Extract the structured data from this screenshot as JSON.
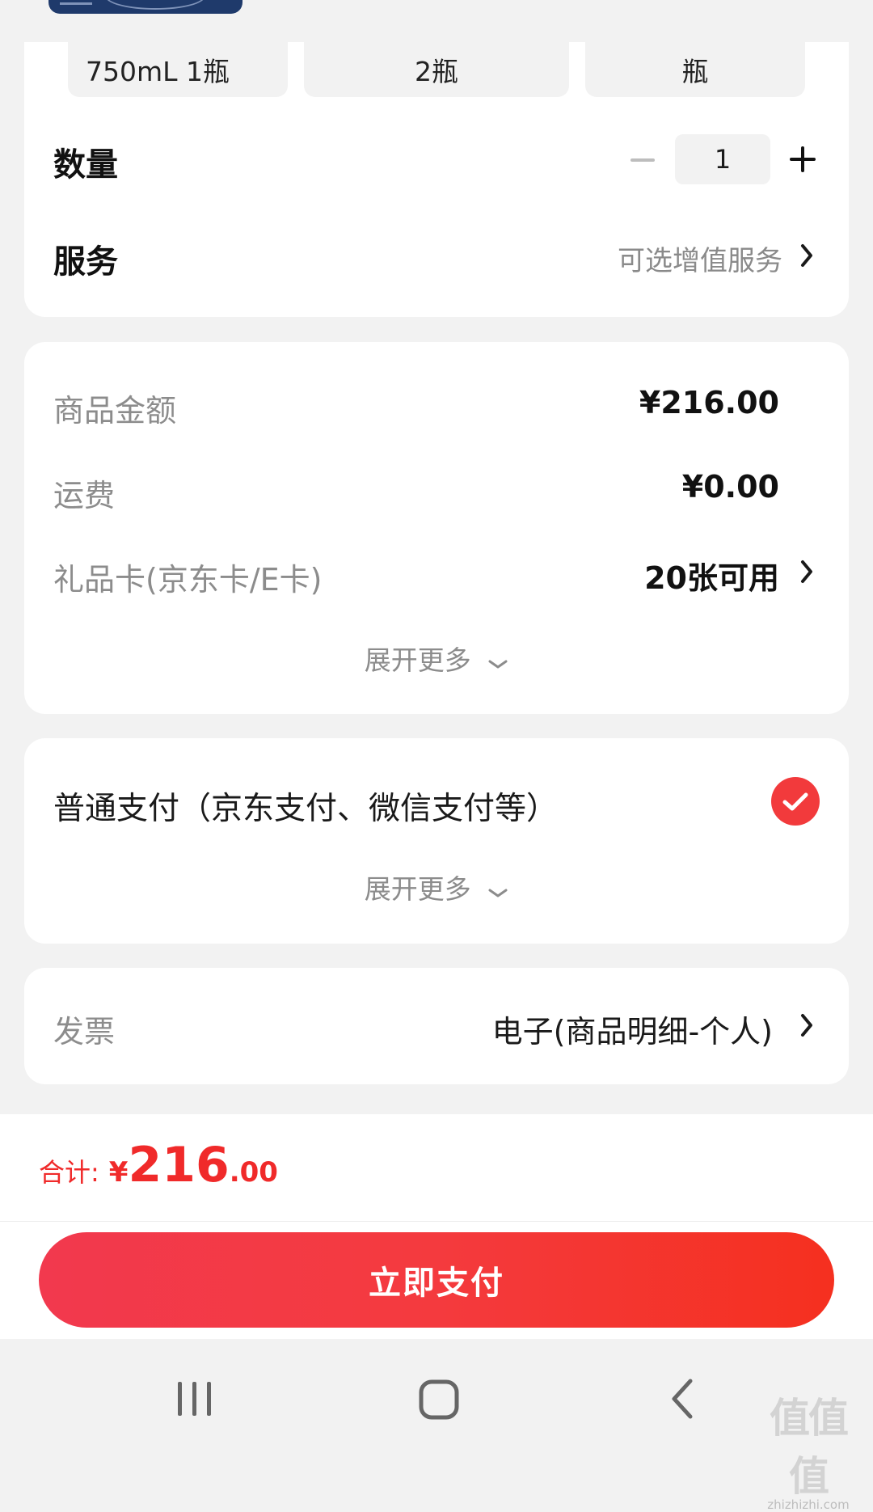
{
  "product": {
    "specs": [
      "750mL 1瓶",
      "2瓶",
      "瓶"
    ]
  },
  "quantity": {
    "label": "数量",
    "value": "1"
  },
  "service": {
    "label": "服务",
    "value": "可选增值服务"
  },
  "amounts": {
    "goods_label": "商品金额",
    "goods_value": "¥216.00",
    "shipping_label": "运费",
    "shipping_value": "¥0.00",
    "giftcard_label": "礼品卡(京东卡/E卡)",
    "giftcard_value": "20张可用",
    "expand_label": "展开更多"
  },
  "payment": {
    "method_label": "普通支付（京东支付、微信支付等）",
    "selected": true,
    "expand_label": "展开更多"
  },
  "invoice": {
    "label": "发票",
    "value": "电子(商品明细-个人)"
  },
  "total": {
    "label": "合计:",
    "currency": "¥",
    "integer": "216",
    "decimal": ".00"
  },
  "pay_button": "立即支付",
  "watermark": {
    "main": "值值值",
    "sub": "zhizhizhi.com"
  },
  "colors": {
    "accent": "#f23a3c",
    "background": "#f2f2f2"
  },
  "icons": {
    "nav_recent": "recent-apps-icon",
    "nav_home": "home-icon",
    "nav_back": "back-icon"
  }
}
